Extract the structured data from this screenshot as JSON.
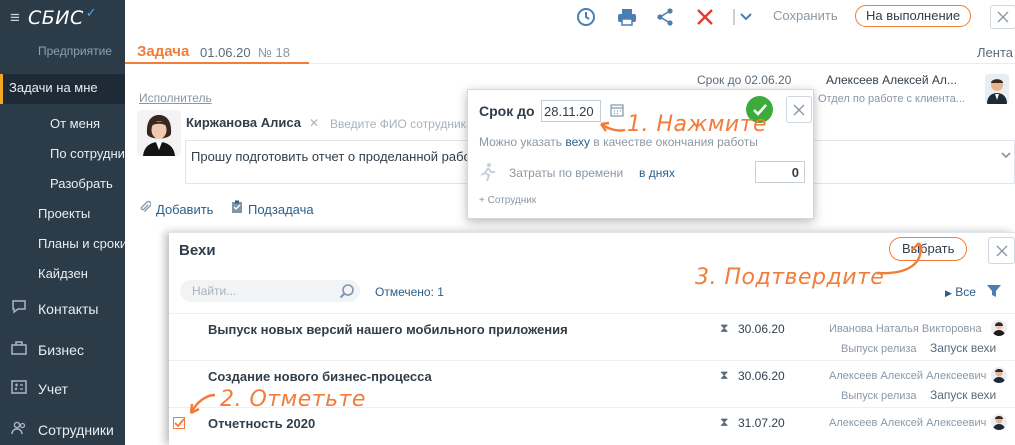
{
  "sidebar": {
    "brand": "СБИС",
    "subtitle": "Предприятие",
    "items": [
      {
        "label": "Задачи на мне",
        "active": true
      },
      {
        "label": "От меня"
      },
      {
        "label": "По сотрудникам"
      },
      {
        "label": "Разобрать"
      },
      {
        "label": "Проекты"
      },
      {
        "label": "Планы и сроки"
      },
      {
        "label": "Кайдзен"
      },
      {
        "label": "Контакты",
        "icon": "chat-icon"
      },
      {
        "label": "Бизнес",
        "icon": "briefcase-icon"
      },
      {
        "label": "Учет",
        "icon": "calculator-icon"
      },
      {
        "label": "Сотрудники",
        "icon": "people-icon"
      }
    ]
  },
  "toolbar": {
    "save_label": "Сохранить",
    "status_label": "На выполнение"
  },
  "document": {
    "title": "Задача",
    "date": "01.06.20",
    "number": "№ 18",
    "feed_label": "Лента",
    "deadline": "Срок до 02.06.20",
    "author_name": "Алексеев Алексей Ал...",
    "author_dept": "Отдел по работе с клиента...",
    "executor_label": "Исполнитель",
    "executor_name": "Киржанова Алиса",
    "executor_placeholder": "Введите ФИО сотрудника",
    "task_text": "Прошу подготовить отчет о проделанной работе",
    "add_label": "Добавить",
    "subtask_label": "Подзадача"
  },
  "deadline_popup": {
    "label": "Срок до",
    "date": "28.11.20",
    "hint_before": "Можно указать ",
    "hint_link": "веху",
    "hint_after": " в качестве окончания работы",
    "time_label": "Затраты по времени",
    "time_unit": "в днях",
    "time_value": "0",
    "employee_label": "+ Сотрудник"
  },
  "milestones": {
    "title": "Вехи",
    "select_label": "Выбрать",
    "search_placeholder": "Найти...",
    "marked_label": "Отмечено: 1",
    "all_label": "Все",
    "rows": [
      {
        "name": "Выпуск новых версий нашего мобильного приложения",
        "date": "30.06.20",
        "person": "Иванова Наталья Викторовна",
        "tag1": "Выпуск релиза",
        "tag2": "Запуск вехи",
        "checked": false
      },
      {
        "name": "Создание нового бизнес-процесса",
        "date": "30.06.20",
        "person": "Алексеев Алексей Алексеевич",
        "tag1": "Выпуск релиза",
        "tag2": "Запуск вехи",
        "checked": false
      },
      {
        "name": "Отчетность 2020",
        "date": "31.07.20",
        "person": "Алексеев Алексей Алексеевич",
        "checked": true
      }
    ]
  },
  "annotations": {
    "step1": "1. Нажмите",
    "step2": "2. Отметьте",
    "step3": "3. Подтвердите"
  },
  "colors": {
    "accent": "#f27c3a",
    "sidebar": "#2b3b48",
    "link": "#2b5e8a",
    "ok": "#3cab3c"
  }
}
